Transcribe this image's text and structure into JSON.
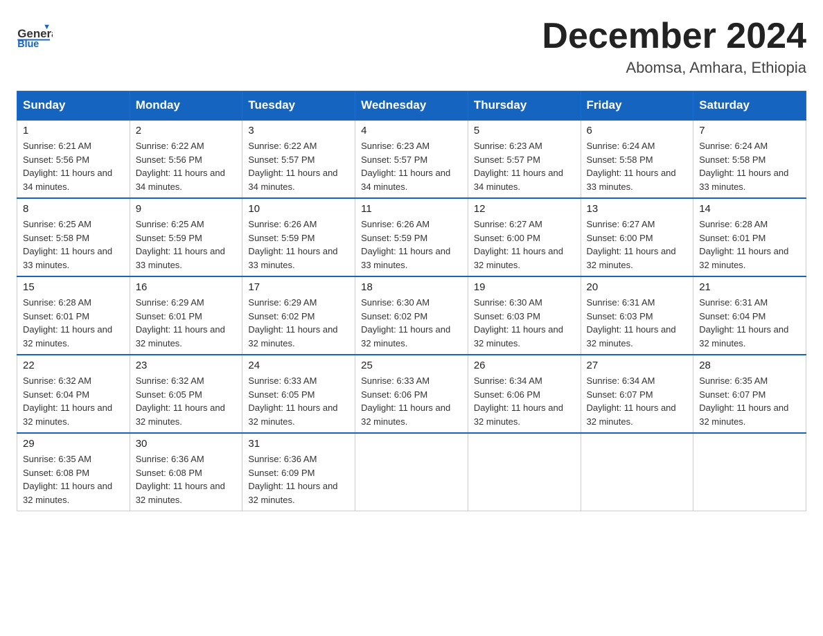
{
  "header": {
    "logo_general": "General",
    "logo_blue": "Blue",
    "month_title": "December 2024",
    "subtitle": "Abomsa, Amhara, Ethiopia"
  },
  "weekdays": [
    "Sunday",
    "Monday",
    "Tuesday",
    "Wednesday",
    "Thursday",
    "Friday",
    "Saturday"
  ],
  "weeks": [
    [
      {
        "day": "1",
        "sunrise": "6:21 AM",
        "sunset": "5:56 PM",
        "daylight": "11 hours and 34 minutes."
      },
      {
        "day": "2",
        "sunrise": "6:22 AM",
        "sunset": "5:56 PM",
        "daylight": "11 hours and 34 minutes."
      },
      {
        "day": "3",
        "sunrise": "6:22 AM",
        "sunset": "5:57 PM",
        "daylight": "11 hours and 34 minutes."
      },
      {
        "day": "4",
        "sunrise": "6:23 AM",
        "sunset": "5:57 PM",
        "daylight": "11 hours and 34 minutes."
      },
      {
        "day": "5",
        "sunrise": "6:23 AM",
        "sunset": "5:57 PM",
        "daylight": "11 hours and 34 minutes."
      },
      {
        "day": "6",
        "sunrise": "6:24 AM",
        "sunset": "5:58 PM",
        "daylight": "11 hours and 33 minutes."
      },
      {
        "day": "7",
        "sunrise": "6:24 AM",
        "sunset": "5:58 PM",
        "daylight": "11 hours and 33 minutes."
      }
    ],
    [
      {
        "day": "8",
        "sunrise": "6:25 AM",
        "sunset": "5:58 PM",
        "daylight": "11 hours and 33 minutes."
      },
      {
        "day": "9",
        "sunrise": "6:25 AM",
        "sunset": "5:59 PM",
        "daylight": "11 hours and 33 minutes."
      },
      {
        "day": "10",
        "sunrise": "6:26 AM",
        "sunset": "5:59 PM",
        "daylight": "11 hours and 33 minutes."
      },
      {
        "day": "11",
        "sunrise": "6:26 AM",
        "sunset": "5:59 PM",
        "daylight": "11 hours and 33 minutes."
      },
      {
        "day": "12",
        "sunrise": "6:27 AM",
        "sunset": "6:00 PM",
        "daylight": "11 hours and 32 minutes."
      },
      {
        "day": "13",
        "sunrise": "6:27 AM",
        "sunset": "6:00 PM",
        "daylight": "11 hours and 32 minutes."
      },
      {
        "day": "14",
        "sunrise": "6:28 AM",
        "sunset": "6:01 PM",
        "daylight": "11 hours and 32 minutes."
      }
    ],
    [
      {
        "day": "15",
        "sunrise": "6:28 AM",
        "sunset": "6:01 PM",
        "daylight": "11 hours and 32 minutes."
      },
      {
        "day": "16",
        "sunrise": "6:29 AM",
        "sunset": "6:01 PM",
        "daylight": "11 hours and 32 minutes."
      },
      {
        "day": "17",
        "sunrise": "6:29 AM",
        "sunset": "6:02 PM",
        "daylight": "11 hours and 32 minutes."
      },
      {
        "day": "18",
        "sunrise": "6:30 AM",
        "sunset": "6:02 PM",
        "daylight": "11 hours and 32 minutes."
      },
      {
        "day": "19",
        "sunrise": "6:30 AM",
        "sunset": "6:03 PM",
        "daylight": "11 hours and 32 minutes."
      },
      {
        "day": "20",
        "sunrise": "6:31 AM",
        "sunset": "6:03 PM",
        "daylight": "11 hours and 32 minutes."
      },
      {
        "day": "21",
        "sunrise": "6:31 AM",
        "sunset": "6:04 PM",
        "daylight": "11 hours and 32 minutes."
      }
    ],
    [
      {
        "day": "22",
        "sunrise": "6:32 AM",
        "sunset": "6:04 PM",
        "daylight": "11 hours and 32 minutes."
      },
      {
        "day": "23",
        "sunrise": "6:32 AM",
        "sunset": "6:05 PM",
        "daylight": "11 hours and 32 minutes."
      },
      {
        "day": "24",
        "sunrise": "6:33 AM",
        "sunset": "6:05 PM",
        "daylight": "11 hours and 32 minutes."
      },
      {
        "day": "25",
        "sunrise": "6:33 AM",
        "sunset": "6:06 PM",
        "daylight": "11 hours and 32 minutes."
      },
      {
        "day": "26",
        "sunrise": "6:34 AM",
        "sunset": "6:06 PM",
        "daylight": "11 hours and 32 minutes."
      },
      {
        "day": "27",
        "sunrise": "6:34 AM",
        "sunset": "6:07 PM",
        "daylight": "11 hours and 32 minutes."
      },
      {
        "day": "28",
        "sunrise": "6:35 AM",
        "sunset": "6:07 PM",
        "daylight": "11 hours and 32 minutes."
      }
    ],
    [
      {
        "day": "29",
        "sunrise": "6:35 AM",
        "sunset": "6:08 PM",
        "daylight": "11 hours and 32 minutes."
      },
      {
        "day": "30",
        "sunrise": "6:36 AM",
        "sunset": "6:08 PM",
        "daylight": "11 hours and 32 minutes."
      },
      {
        "day": "31",
        "sunrise": "6:36 AM",
        "sunset": "6:09 PM",
        "daylight": "11 hours and 32 minutes."
      },
      null,
      null,
      null,
      null
    ]
  ],
  "labels": {
    "sunrise": "Sunrise:",
    "sunset": "Sunset:",
    "daylight": "Daylight:"
  }
}
